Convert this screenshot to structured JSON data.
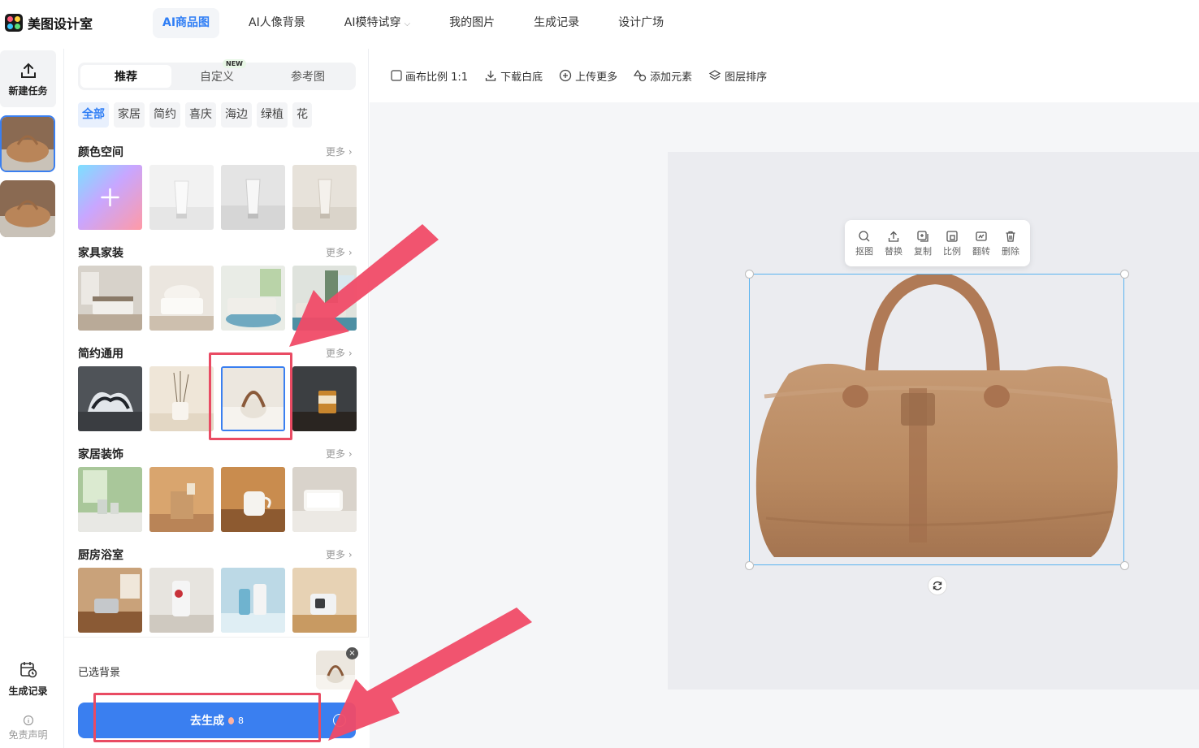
{
  "app": {
    "name": "美图设计室"
  },
  "nav": [
    {
      "label": "AI商品图",
      "active": true
    },
    {
      "label": "AI人像背景",
      "active": false
    },
    {
      "label": "AI模特试穿",
      "active": false,
      "dropdown": true
    },
    {
      "label": "我的图片",
      "active": false
    },
    {
      "label": "生成记录",
      "active": false
    },
    {
      "label": "设计广场",
      "active": false
    }
  ],
  "rail": {
    "new_task": "新建任务",
    "history": "生成记录",
    "disclaimer": "免责声明"
  },
  "panel": {
    "tabs": [
      {
        "label": "推荐",
        "active": true
      },
      {
        "label": "自定义",
        "badge": "NEW"
      },
      {
        "label": "参考图"
      }
    ],
    "chips": [
      "全部",
      "家居",
      "简约",
      "喜庆",
      "海边",
      "绿植",
      "花"
    ],
    "more_label": "更多",
    "sections": [
      {
        "title": "颜色空间"
      },
      {
        "title": "家具家装"
      },
      {
        "title": "简约通用"
      },
      {
        "title": "家居装饰"
      },
      {
        "title": "厨房浴室"
      }
    ],
    "chosen_label": "已选背景",
    "generate_label": "去生成",
    "generate_cost": "8",
    "close_glyph": "×",
    "info_glyph": "!"
  },
  "toolbar": [
    {
      "label": "画布比例 1:1",
      "icon": "checkbox-icon"
    },
    {
      "label": "下载白底",
      "icon": "download-icon"
    },
    {
      "label": "上传更多",
      "icon": "plus-circle-icon"
    },
    {
      "label": "添加元素",
      "icon": "shapes-icon"
    },
    {
      "label": "图层排序",
      "icon": "layers-icon"
    }
  ],
  "float_tools": [
    "抠图",
    "替换",
    "复制",
    "比例",
    "翻转",
    "删除"
  ],
  "colors": {
    "accent": "#3a7ff0",
    "annotation": "#e94b63",
    "selection": "#59b3f0"
  }
}
